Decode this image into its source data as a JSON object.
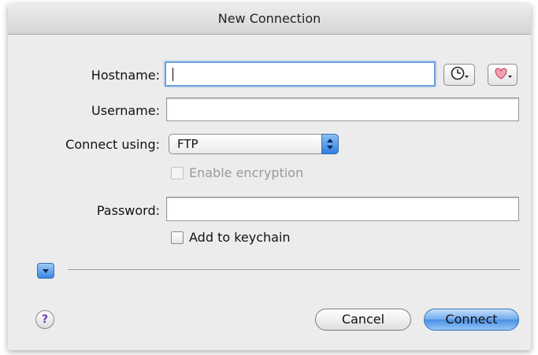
{
  "window": {
    "title": "New Connection"
  },
  "form": {
    "hostname_label": "Hostname:",
    "hostname_value": "",
    "username_label": "Username:",
    "username_value": "",
    "connect_using_label": "Connect using:",
    "protocol_selected": "FTP",
    "encryption_label": "Enable encryption",
    "encryption_enabled": false,
    "encryption_checked": false,
    "password_label": "Password:",
    "password_value": "",
    "keychain_label": "Add to keychain",
    "keychain_checked": false
  },
  "icons": {
    "history": "clock-icon",
    "bookmarks": "heart-icon",
    "disclosure": "disclosure-triangle-icon",
    "help": "help-icon",
    "help_glyph": "?"
  },
  "buttons": {
    "cancel_label": "Cancel",
    "connect_label": "Connect"
  },
  "colors": {
    "accent": "#4a8fe3",
    "focus_ring": "#6aa1dd",
    "heart": "#e0566f"
  }
}
